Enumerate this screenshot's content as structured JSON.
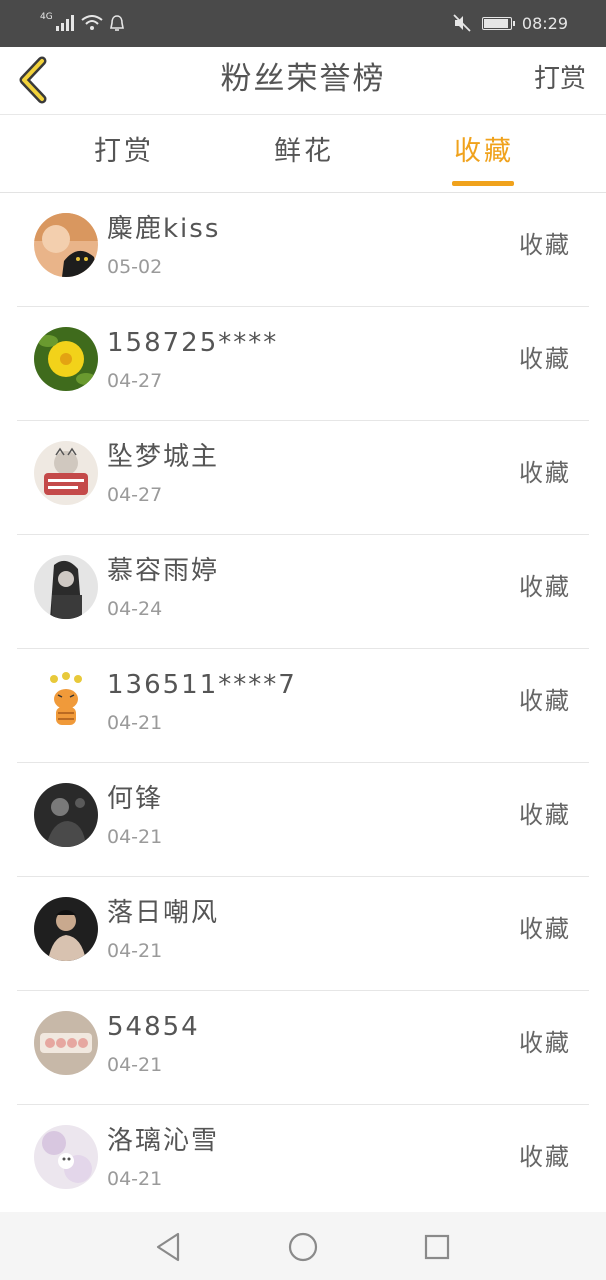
{
  "status": {
    "network": "4G",
    "time": "08:29",
    "battery_level": 0.95,
    "icons": [
      "signal-icon",
      "wifi-icon",
      "notification-icon",
      "mute-icon",
      "battery-icon"
    ]
  },
  "header": {
    "title": "粉丝荣誉榜",
    "right_label": "打赏",
    "back_icon": "back-chevron-icon"
  },
  "tabs": [
    {
      "label": "打赏"
    },
    {
      "label": "鲜花"
    },
    {
      "label": "收藏",
      "active": true
    }
  ],
  "colors": {
    "accent": "#f0a21c",
    "statusbar": "#4a4a4a"
  },
  "rows": [
    {
      "name": "麋鹿kiss",
      "date": "05-02",
      "action": "收藏"
    },
    {
      "name": "158725****",
      "date": "04-27",
      "action": "收藏"
    },
    {
      "name": "坠梦城主",
      "date": "04-27",
      "action": "收藏"
    },
    {
      "name": "慕容雨婷",
      "date": "04-24",
      "action": "收藏"
    },
    {
      "name": "136511****7",
      "date": "04-21",
      "action": "收藏"
    },
    {
      "name": "何锋",
      "date": "04-21",
      "action": "收藏"
    },
    {
      "name": "落日嘲风",
      "date": "04-21",
      "action": "收藏"
    },
    {
      "name": "54854",
      "date": "04-21",
      "action": "收藏"
    },
    {
      "name": "洛璃沁雪",
      "date": "04-21",
      "action": "收藏"
    }
  ],
  "navigation": {
    "buttons": [
      "back-triangle-icon",
      "home-circle-icon",
      "recents-square-icon"
    ]
  }
}
